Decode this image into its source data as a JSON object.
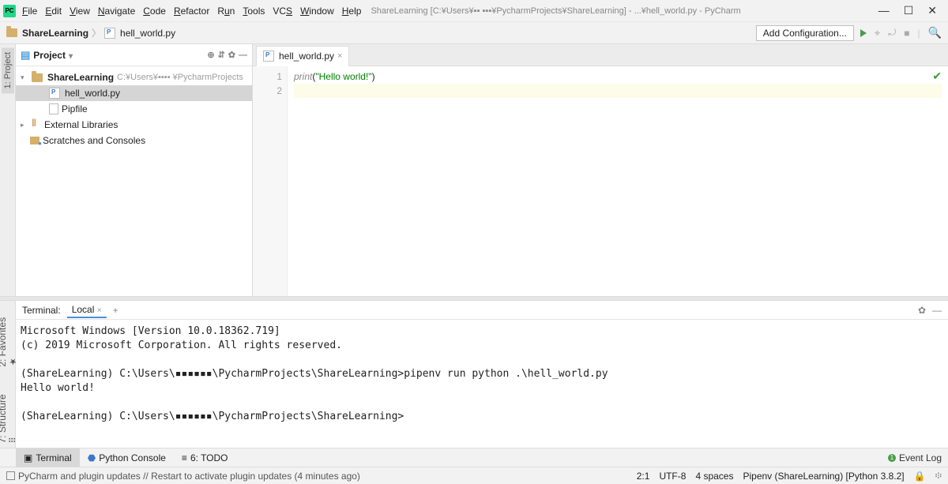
{
  "menu": {
    "file": "File",
    "edit": "Edit",
    "view": "View",
    "navigate": "Navigate",
    "code": "Code",
    "refactor": "Refactor",
    "run": "Run",
    "tools": "Tools",
    "vcs": "VCS",
    "window": "Window",
    "help": "Help"
  },
  "titlepath": "ShareLearning [C:¥Users¥▪▪ ▪▪▪¥PycharmProjects¥ShareLearning] - ...¥hell_world.py - PyCharm",
  "breadcrumb": {
    "project": "ShareLearning",
    "file": "hell_world.py"
  },
  "addconfig_label": "Add Configuration...",
  "project_panel": {
    "title": "Project",
    "root_name": "ShareLearning",
    "root_path": "C:¥Users¥▪▪▪▪ ¥PycharmProjects",
    "file_py": "hell_world.py",
    "file_pip": "Pipfile",
    "ext_lib": "External Libraries",
    "scratches": "Scratches and Consoles"
  },
  "left_tabs": {
    "project": "1: Project",
    "favorites": "2: Favorites",
    "structure": "7: Structure"
  },
  "editor": {
    "tab_name": "hell_world.py",
    "line1_ident": "print",
    "line1_paren_open": "(",
    "line1_str": "\"Hello world!\"",
    "line1_paren_close": ")",
    "gutter": [
      "1",
      "2"
    ]
  },
  "terminal": {
    "label": "Terminal:",
    "tab": "Local",
    "lines": [
      "Microsoft Windows [Version 10.0.18362.719]",
      "(c) 2019 Microsoft Corporation. All rights reserved.",
      "",
      "(ShareLearning) C:\\Users\\▪▪▪▪▪▪\\PycharmProjects\\ShareLearning>pipenv run python .\\hell_world.py",
      "Hello world!",
      "",
      "(ShareLearning) C:\\Users\\▪▪▪▪▪▪\\PycharmProjects\\ShareLearning>"
    ]
  },
  "bottom_tabs": {
    "terminal": "Terminal",
    "python_console": "Python Console",
    "todo": "6: TODO",
    "event_log": "Event Log"
  },
  "status": {
    "msg": "PyCharm and plugin updates // Restart to activate plugin updates (4 minutes ago)",
    "pos": "2:1",
    "enc": "UTF-8",
    "indent": "4 spaces",
    "interp": "Pipenv (ShareLearning) [Python 3.8.2]"
  }
}
